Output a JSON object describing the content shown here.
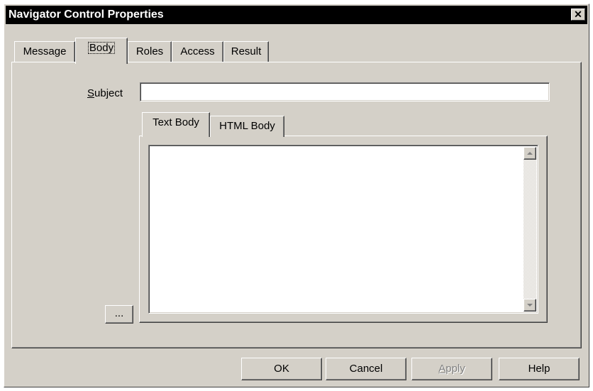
{
  "window": {
    "title": "Navigator Control Properties",
    "close_symbol": "✕"
  },
  "tabs": [
    {
      "label": "Message",
      "active": false
    },
    {
      "label": "Body",
      "active": true
    },
    {
      "label": "Roles",
      "active": false
    },
    {
      "label": "Access",
      "active": false
    },
    {
      "label": "Result",
      "active": false
    }
  ],
  "body_tab": {
    "subject_label_access_key": "S",
    "subject_label_rest": "ubject",
    "subject_value": "",
    "inner_tabs": [
      {
        "label": "Text Body",
        "active": true
      },
      {
        "label": "HTML Body",
        "active": false
      }
    ],
    "text_body_value": "",
    "browse_button_label": "..."
  },
  "buttons": {
    "ok": "OK",
    "cancel": "Cancel",
    "apply_access_key": "A",
    "apply_rest": "pply",
    "help": "Help"
  },
  "icons": {
    "scroll_up": "scroll-up-arrow-icon",
    "scroll_down": "scroll-down-arrow-icon",
    "close": "close-icon"
  },
  "colors": {
    "dialog_face": "#d4d0c8",
    "title_bar": "#000000",
    "disabled_text": "#808080"
  }
}
